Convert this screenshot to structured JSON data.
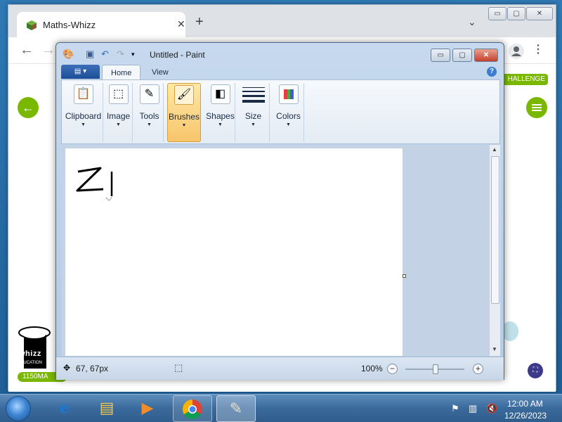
{
  "browser": {
    "tab_title": "Maths-Whizz",
    "tab_close": "✕",
    "new_tab": "+",
    "tab_search": "⌄",
    "window_controls": {
      "minimize": "▭",
      "maximize": "▢",
      "close": "✕"
    },
    "nav": {
      "back": "←",
      "forward": "→",
      "menu": "⋮"
    }
  },
  "web_page": {
    "challenge_label": "HALLENGE",
    "logo_text": "whizz",
    "logo_subtext": "EDUCATION",
    "maths_age_label": "1150MA",
    "back_button": "←"
  },
  "paint": {
    "title": "Untitled - Paint",
    "tabs": [
      {
        "label": "Home",
        "active": true
      },
      {
        "label": "View",
        "active": false
      }
    ],
    "help": "?",
    "groups": [
      {
        "label": "Clipboard",
        "icon": "clipboard-icon"
      },
      {
        "label": "Image",
        "icon": "select-icon"
      },
      {
        "label": "Tools",
        "icon": "tools-icon"
      },
      {
        "label": "Brushes",
        "icon": "brush-icon",
        "active": true
      },
      {
        "label": "Shapes",
        "icon": "shapes-icon"
      },
      {
        "label": "Size",
        "icon": "size-icon"
      },
      {
        "label": "Colors",
        "icon": "colors-icon"
      }
    ],
    "canvas_text": "ZI",
    "status": {
      "coords": "67, 67px",
      "zoom": "100%",
      "zoom_out": "−",
      "zoom_in": "+"
    }
  },
  "taskbar": {
    "apps": [
      {
        "name": "internet-explorer",
        "icon": "e"
      },
      {
        "name": "file-explorer",
        "icon": "▤"
      },
      {
        "name": "media-player",
        "icon": "▶"
      },
      {
        "name": "chrome",
        "icon": "◉"
      },
      {
        "name": "paint",
        "icon": "✎"
      }
    ],
    "clock": {
      "time": "12:00 AM",
      "date": "12/26/2023"
    }
  },
  "colors": {
    "accent_green": "#7ab800",
    "paint_frame": "#b4cbe4",
    "taskbar": "#3a6a9c"
  }
}
